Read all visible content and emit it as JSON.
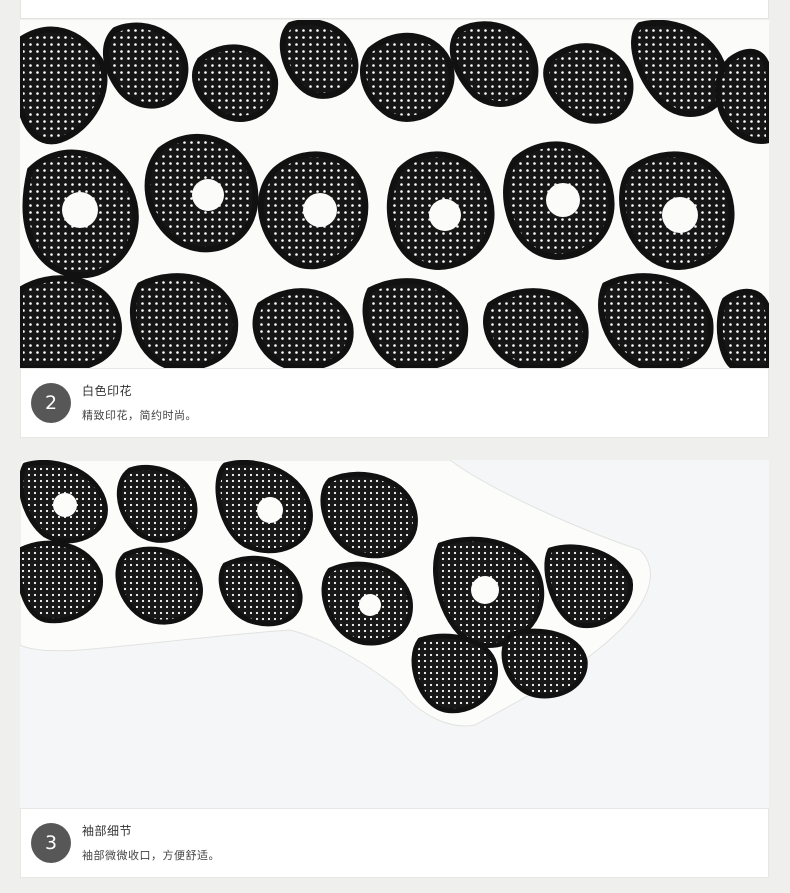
{
  "sections": [
    {
      "step_number": "2",
      "title": "白色印花",
      "description": "精致印花，简约时尚。",
      "image_alt": "black and white floral dotted print fabric close-up"
    },
    {
      "step_number": "3",
      "title": "袖部细节",
      "description": "袖部微微收口，方便舒适。",
      "image_alt": "sleeve cuff detail with black floral dotted print"
    }
  ],
  "colors": {
    "page_background": "#efefed",
    "card_background": "#ffffff",
    "badge": "#575757",
    "print_black": "#1a1a1a"
  }
}
